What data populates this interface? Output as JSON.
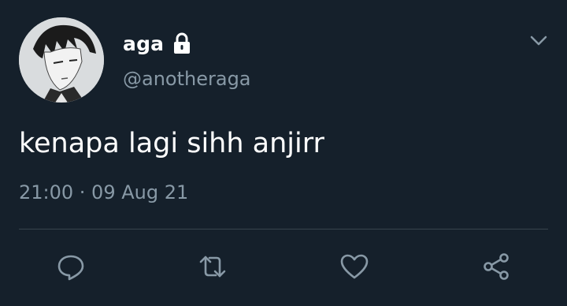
{
  "tweet": {
    "display_name": "aga",
    "handle": "@anotheraga",
    "text": "kenapa lagi sihh anjirr",
    "timestamp": "21:00 · 09 Aug 21",
    "protected": true
  },
  "icons": {
    "lock": "lock-icon",
    "caret": "chevron-down-icon",
    "reply": "reply-icon",
    "retweet": "retweet-icon",
    "like": "heart-icon",
    "share": "share-icon"
  },
  "colors": {
    "background": "#15202b",
    "text_primary": "#ffffff",
    "text_secondary": "#8899a6",
    "divider": "#38444d"
  }
}
